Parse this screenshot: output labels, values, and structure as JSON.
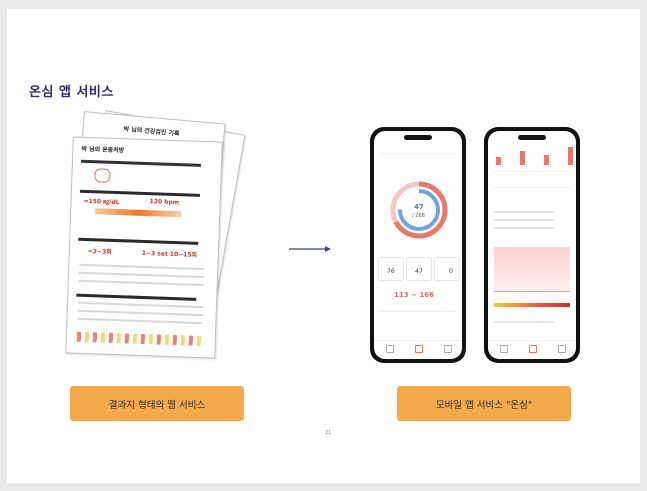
{
  "slide": {
    "title": "온심 앱 서비스",
    "page_number": "21"
  },
  "left_section": {
    "button_label": "결과지 형태의 웹 서비스",
    "documents": {
      "back_title": "박  님의 건강검진 기록",
      "front_title": "박  님의 운동처방",
      "value_a": "≈150 ㎎/dL",
      "value_b": "120 bpm",
      "value_c": "≈2~3회",
      "value_d": "1~3 set  10~15회"
    }
  },
  "arrow": {
    "icon": "arrow-right-icon",
    "color": "#3b3f8f"
  },
  "right_section": {
    "button_label": "모바일 앱 서비스 \"온심\"",
    "phone_left": {
      "ring_value": "47",
      "ring_sub": "/ 268",
      "stat_values": [
        "76",
        "47",
        "0"
      ],
      "range_text": "113 ~ 166"
    },
    "phone_right": {}
  },
  "colors": {
    "accent_orange": "#f5a94d",
    "title_navy": "#2f2a6b",
    "ring_blue": "#6fa4e0",
    "ring_red": "#e9786b"
  }
}
